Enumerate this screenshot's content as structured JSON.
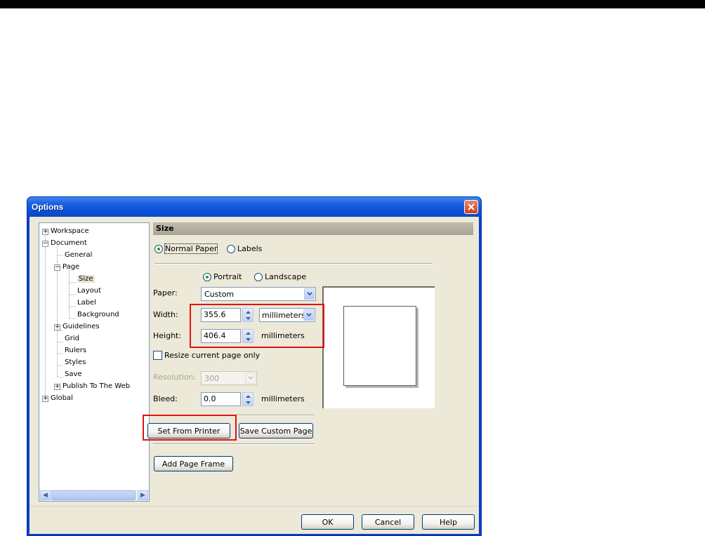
{
  "window": {
    "title": "Options"
  },
  "tree": {
    "items": [
      {
        "label": "Workspace",
        "expander": "+"
      },
      {
        "label": "Document",
        "expander": "−"
      },
      {
        "label": "General"
      },
      {
        "label": "Page",
        "expander": "−"
      },
      {
        "label": "Size",
        "selected": true
      },
      {
        "label": "Layout"
      },
      {
        "label": "Label"
      },
      {
        "label": "Background"
      },
      {
        "label": "Guidelines",
        "expander": "+"
      },
      {
        "label": "Grid"
      },
      {
        "label": "Rulers"
      },
      {
        "label": "Styles"
      },
      {
        "label": "Save"
      },
      {
        "label": "Publish To The Web",
        "expander": "+"
      },
      {
        "label": "Global",
        "expander": "+"
      }
    ]
  },
  "panel": {
    "title": "Size",
    "paper_type": {
      "normal": "Normal Paper",
      "labels": "Labels",
      "selected": "normal"
    },
    "orientation": {
      "portrait": "Portrait",
      "landscape": "Landscape",
      "selected": "portrait"
    },
    "paper": {
      "label": "Paper:",
      "value": "Custom"
    },
    "width": {
      "label": "Width:",
      "value": "355.6",
      "unit": "millimeters"
    },
    "height": {
      "label": "Height:",
      "value": "406.4",
      "unit": "millimeters"
    },
    "resize_current": {
      "label": "Resize current page only",
      "checked": false
    },
    "resolution": {
      "label": "Resolution:",
      "value": "300"
    },
    "bleed": {
      "label": "Bleed:",
      "value": "0.0",
      "unit": "millimeters"
    },
    "set_from_printer": "Set From Printer",
    "save_custom_page": "Save Custom Page",
    "add_page_frame": "Add Page Frame"
  },
  "footer": {
    "ok": "OK",
    "cancel": "Cancel",
    "help": "Help"
  },
  "colors": {
    "highlight": "#e01313",
    "titlebar": "#0a50d8"
  }
}
